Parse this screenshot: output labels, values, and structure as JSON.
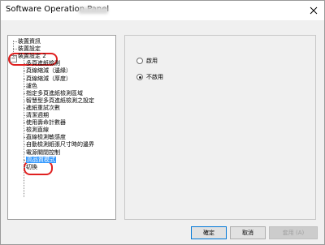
{
  "window": {
    "title": "Software Operation Panel"
  },
  "tree": {
    "items": [
      {
        "label": "裝置資訊",
        "level": 0
      },
      {
        "label": "裝置設定",
        "level": 0
      },
      {
        "label": "裝置設定 2",
        "level": 0
      },
      {
        "label": "多頁進紙檢測",
        "level": 1
      },
      {
        "label": "頁線縮減（邊緣）",
        "level": 1
      },
      {
        "label": "頁線縮減（厚度）",
        "level": 1
      },
      {
        "label": "濾色",
        "level": 1
      },
      {
        "label": "指定多頁進紙檢測區域",
        "level": 1
      },
      {
        "label": "智慧型多頁進紙檢測之設定",
        "level": 1
      },
      {
        "label": "進紙重試次數",
        "level": 1
      },
      {
        "label": "清潔週期",
        "level": 1
      },
      {
        "label": "使用壽命計數器",
        "level": 1
      },
      {
        "label": "檢測直線",
        "level": 1
      },
      {
        "label": "直線檢測敏感度",
        "level": 1
      },
      {
        "label": "自動檢測紙張尺寸時的邊界",
        "level": 1
      },
      {
        "label": "電源關閉控制",
        "level": 1
      },
      {
        "label": "高品質模式",
        "level": 1,
        "selected": true
      },
      {
        "label": "切換",
        "level": 1
      }
    ],
    "expander": "−"
  },
  "options": {
    "radio": [
      {
        "label": "啟用",
        "checked": false
      },
      {
        "label": "不啟用",
        "checked": true
      }
    ]
  },
  "buttons": {
    "ok": "確定",
    "cancel": "取消",
    "apply": "套用 (A)"
  },
  "colors": {
    "highlight": "#e02020",
    "selection": "#3399ff"
  }
}
